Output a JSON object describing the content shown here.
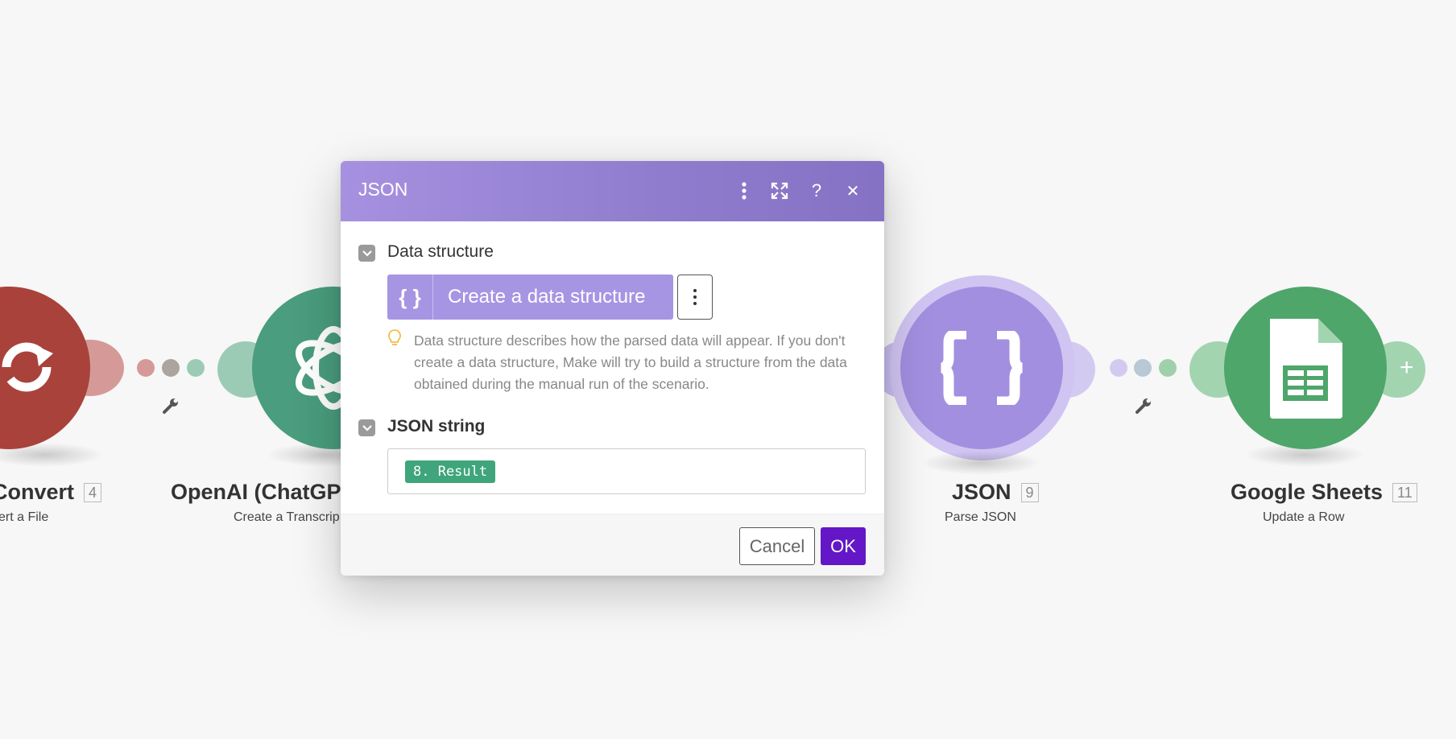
{
  "nodes": [
    {
      "title": "Convert",
      "id": "4",
      "subtitle": "ert a File",
      "color": "#a9423b"
    },
    {
      "title": "OpenAI (ChatGPT, W",
      "subtitle": "Create a Transcrip",
      "color": "#4a9d7e"
    },
    {
      "title": "JSON",
      "id": "9",
      "subtitle": "Parse JSON",
      "color": "#a28fe0"
    },
    {
      "title": "Google Sheets",
      "id": "11",
      "subtitle": "Update a Row",
      "color": "#4ea66a"
    }
  ],
  "icons": {
    "convert": "refresh-icon",
    "openai": "openai-logo-icon",
    "json": "braces-icon",
    "sheets": "spreadsheet-icon",
    "wrench": "wrench-icon",
    "add": "plus-icon"
  },
  "modal": {
    "title": "JSON",
    "header_icons": [
      "more-vertical-icon",
      "expand-icon",
      "help-icon",
      "close-icon"
    ],
    "help_glyph": "?",
    "close_glyph": "✕",
    "sections": {
      "data_structure": {
        "label": "Data structure",
        "button_label": "Create a data structure",
        "button_icon": "{ }",
        "hint": "Data structure describes how the parsed data will appear. If you don't create a data structure, Make will try to build a structure from the data obtained during the manual run of the scenario."
      },
      "json_string": {
        "label": "JSON string",
        "value_pill": "8. Result"
      }
    },
    "footer": {
      "cancel_label": "Cancel",
      "ok_label": "OK"
    }
  },
  "colors": {
    "accent_purple": "#a695e3",
    "ok_button": "#6317c6",
    "pill_green": "#3fa57b"
  }
}
